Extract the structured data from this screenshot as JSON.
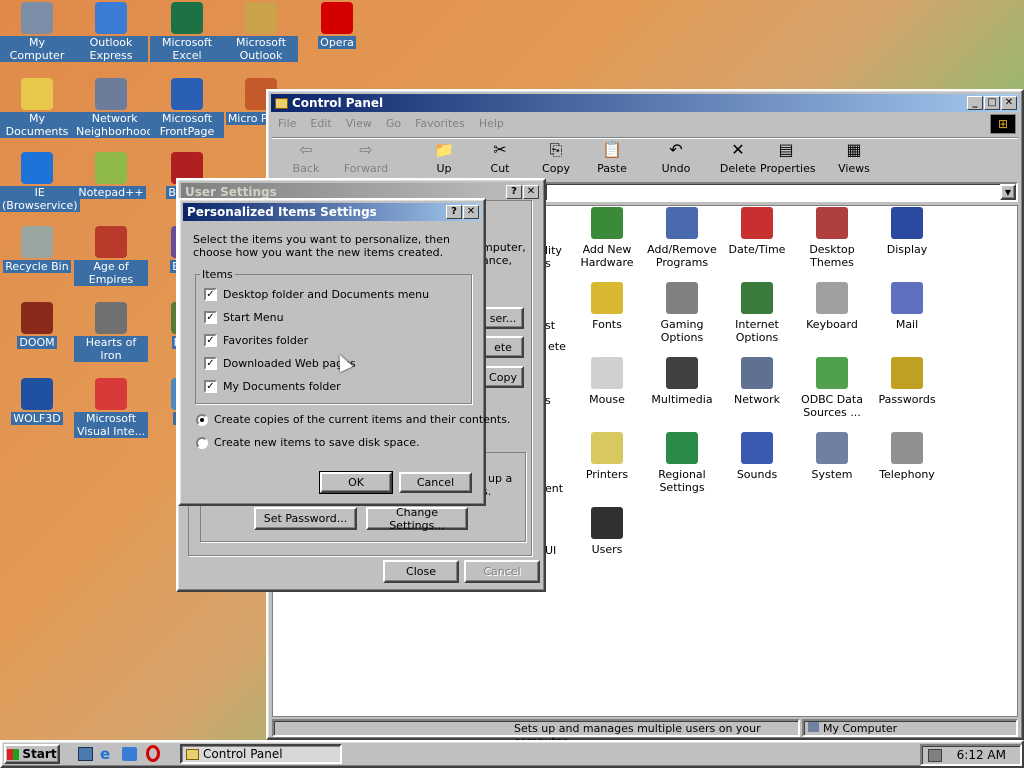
{
  "desktop": {
    "icons": [
      {
        "label": "My Computer",
        "color": "#7d8fa8"
      },
      {
        "label": "Outlook Express",
        "color": "#3a7bd5"
      },
      {
        "label": "Microsoft Excel",
        "color": "#1e7145"
      },
      {
        "label": "Microsoft Outlook",
        "color": "#c9a24a"
      },
      {
        "label": "Opera",
        "color": "#d40000"
      },
      {
        "label": "My Documents",
        "color": "#e8c84a"
      },
      {
        "label": "Network Neighborhood",
        "color": "#6d7c9a"
      },
      {
        "label": "Microsoft FrontPage",
        "color": "#2b5fb4"
      },
      {
        "label": "Micro Power",
        "color": "#c45a2a"
      },
      {
        "label": "IE (Browservice)",
        "color": "#1e73d8"
      },
      {
        "label": "Notepad++",
        "color": "#8fb84a"
      },
      {
        "label": "Bete D",
        "color": "#b02020"
      },
      {
        "label": "Recycle Bin",
        "color": "#9aa6a0"
      },
      {
        "label": "Age of Empires",
        "color": "#b83a2a"
      },
      {
        "label": "Big D",
        "color": "#6a4c9c"
      },
      {
        "label": "DOOM",
        "color": "#8a2a1a"
      },
      {
        "label": "Hearts of Iron",
        "color": "#707070"
      },
      {
        "label": "Pagg",
        "color": "#5a7a3a"
      },
      {
        "label": "WOLF3D",
        "color": "#2050a0"
      },
      {
        "label": "Microsoft Visual Inte...",
        "color": "#d83a3a"
      },
      {
        "label": "Pl Zi",
        "color": "#4a8ac0"
      }
    ]
  },
  "control_panel": {
    "title": "Control Panel",
    "menu": [
      "File",
      "Edit",
      "View",
      "Go",
      "Favorites",
      "Help"
    ],
    "toolbar": [
      {
        "label": "Back",
        "icon": "⇦"
      },
      {
        "label": "Forward",
        "icon": "⇨"
      },
      {
        "label": "Up",
        "icon": "📁"
      },
      {
        "label": "Cut",
        "icon": "✂"
      },
      {
        "label": "Copy",
        "icon": "⎘"
      },
      {
        "label": "Paste",
        "icon": "📋"
      },
      {
        "label": "Undo",
        "icon": "↶"
      },
      {
        "label": "Delete",
        "icon": "✕"
      },
      {
        "label": "Properties",
        "icon": "▤"
      },
      {
        "label": "Views",
        "icon": "▦"
      }
    ],
    "partial_labels": [
      "lity",
      "s",
      "st",
      "ete",
      "s",
      "ent",
      "UI"
    ],
    "items": [
      {
        "label": "Add New Hardware",
        "color": "#3a8a3a"
      },
      {
        "label": "Add/Remove Programs",
        "color": "#4a6ab0"
      },
      {
        "label": "Date/Time",
        "color": "#c83030"
      },
      {
        "label": "Desktop Themes",
        "color": "#b04040"
      },
      {
        "label": "Display",
        "color": "#2a4aa0"
      },
      {
        "label": "Fonts",
        "color": "#d8b830"
      },
      {
        "label": "Gaming Options",
        "color": "#808080"
      },
      {
        "label": "Internet Options",
        "color": "#3a7a3a"
      },
      {
        "label": "Keyboard",
        "color": "#a0a0a0"
      },
      {
        "label": "Mail",
        "color": "#6070c0"
      },
      {
        "label": "Mouse",
        "color": "#d0d0d0"
      },
      {
        "label": "Multimedia",
        "color": "#404040"
      },
      {
        "label": "Network",
        "color": "#607090"
      },
      {
        "label": "ODBC Data Sources ...",
        "color": "#50a050"
      },
      {
        "label": "Passwords",
        "color": "#c0a020"
      },
      {
        "label": "Printers",
        "color": "#d8c860"
      },
      {
        "label": "Regional Settings",
        "color": "#2a8a4a"
      },
      {
        "label": "Sounds",
        "color": "#3a5ab0"
      },
      {
        "label": "System",
        "color": "#7080a0"
      },
      {
        "label": "Telephony",
        "color": "#909090"
      },
      {
        "label": "Users",
        "color": "#303030"
      }
    ],
    "status_left": "Sets up and manages multiple users on your computer.",
    "status_right": "My Computer"
  },
  "user_settings": {
    "title": "User Settings",
    "partial_text": [
      "mputer,",
      "ance,",
      "ser...",
      "ete",
      "Copy",
      "up a",
      "s."
    ],
    "set_password": "Set Password...",
    "change_settings": "Change Settings...",
    "close": "Close",
    "cancel": "Cancel"
  },
  "personalized": {
    "title": "Personalized Items Settings",
    "instructions": "Select the items you want to personalize, then choose how you want the new items created.",
    "group_label": "Items",
    "items": [
      "Desktop folder and Documents menu",
      "Start Menu",
      "Favorites folder",
      "Downloaded Web pages",
      "My Documents folder"
    ],
    "option_copy": "Create copies of the current items and their contents.",
    "option_new": "Create new items to save disk space.",
    "ok": "OK",
    "cancel": "Cancel"
  },
  "taskbar": {
    "start": "Start",
    "task": "Control Panel",
    "time": "6:12 AM"
  }
}
